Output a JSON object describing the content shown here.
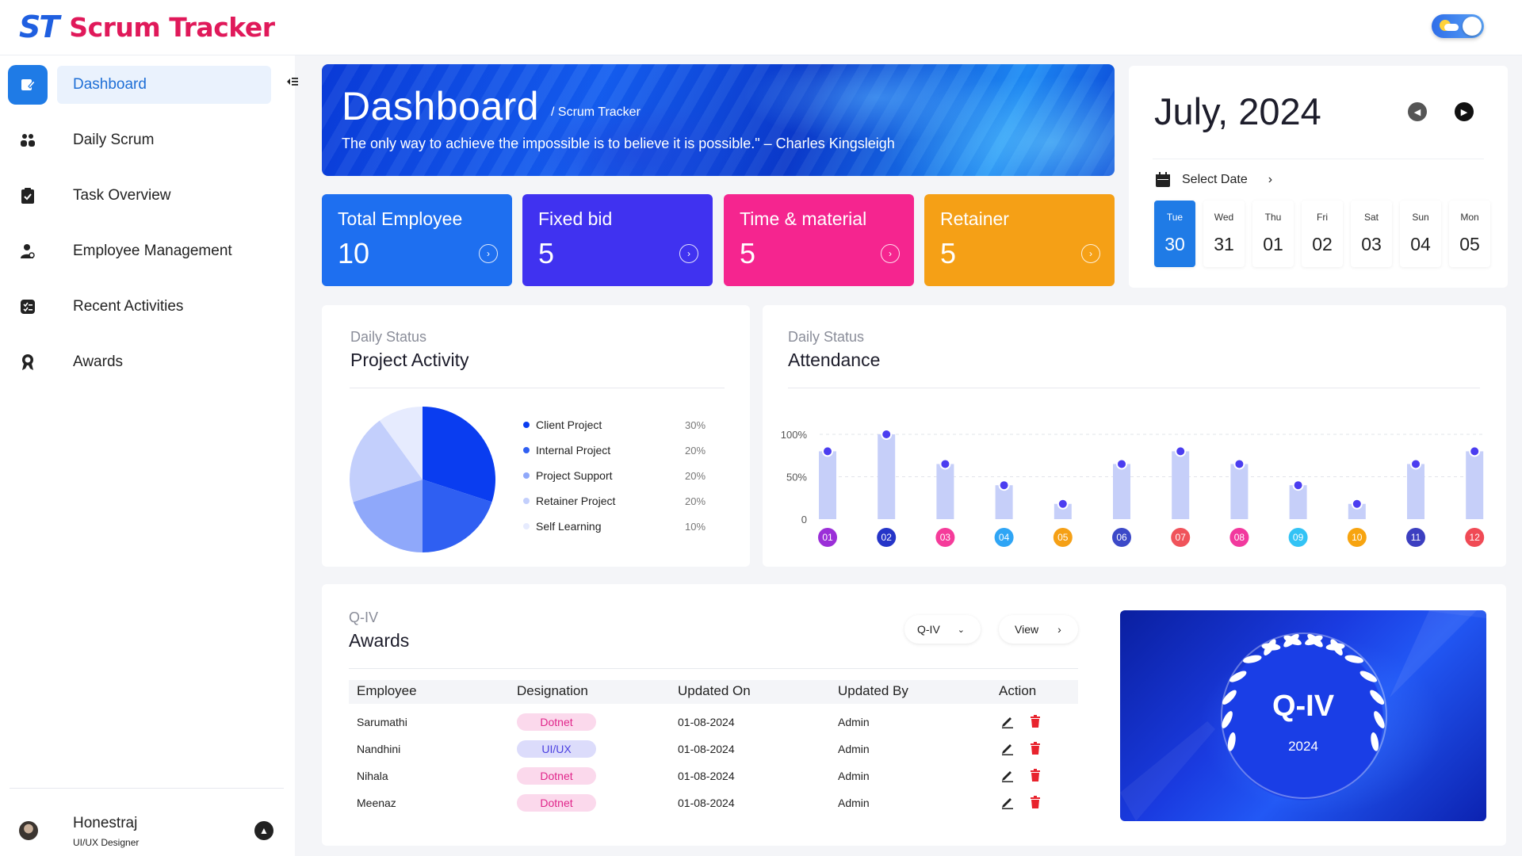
{
  "header": {
    "logo_mark": "ST",
    "logo_text": "Scrum Tracker",
    "theme_toggle": "theme-toggle"
  },
  "sidebar": {
    "items": [
      {
        "label": "Dashboard",
        "icon": "dashboard-icon",
        "active": true
      },
      {
        "label": "Daily Scrum",
        "icon": "team-icon"
      },
      {
        "label": "Task Overview",
        "icon": "clipboard-check-icon"
      },
      {
        "label": "Employee Management",
        "icon": "user-gear-icon"
      },
      {
        "label": "Recent Activities",
        "icon": "checklist-icon"
      },
      {
        "label": "Awards",
        "icon": "award-icon"
      }
    ],
    "user": {
      "name": "Honestraj",
      "role": "UI/UX Designer"
    }
  },
  "banner": {
    "title": "Dashboard",
    "crumb": "/ Scrum Tracker",
    "quote": "The only way to achieve the impossible is to believe it is possible.\" – Charles Kingsleigh"
  },
  "stats": [
    {
      "title": "Total Employee",
      "value": "10",
      "color": "#1e6ff0"
    },
    {
      "title": "Fixed bid",
      "value": "5",
      "color": "#4032f0"
    },
    {
      "title": "Time & material",
      "value": "5",
      "color": "#f5258f"
    },
    {
      "title": "Retainer",
      "value": "5",
      "color": "#f5a016"
    }
  ],
  "calendar": {
    "month": "July, 2024",
    "select_label": "Select Date",
    "days": [
      {
        "dow": "Tue",
        "num": "30",
        "active": true
      },
      {
        "dow": "Wed",
        "num": "31"
      },
      {
        "dow": "Thu",
        "num": "01"
      },
      {
        "dow": "Fri",
        "num": "02"
      },
      {
        "dow": "Sat",
        "num": "03"
      },
      {
        "dow": "Sun",
        "num": "04"
      },
      {
        "dow": "Mon",
        "num": "05"
      }
    ]
  },
  "project_activity": {
    "subtitle": "Daily Status",
    "title": "Project Activity",
    "chart_data": {
      "type": "pie",
      "labels": [
        "Client Project",
        "Internal Project",
        "Project Support",
        "Retainer Project",
        "Self Learning"
      ],
      "values": [
        30,
        20,
        20,
        20,
        10
      ],
      "value_labels": [
        "30%",
        "20%",
        "20%",
        "20%",
        "10%"
      ],
      "colors": [
        "#0a3df0",
        "#2f5ff2",
        "#8fa8fa",
        "#c3cffc",
        "#e6ebfe"
      ]
    }
  },
  "attendance": {
    "subtitle": "Daily Status",
    "title": "Attendance",
    "chart_data": {
      "type": "bar",
      "categories": [
        "01",
        "02",
        "03",
        "04",
        "05",
        "06",
        "07",
        "08",
        "09",
        "10",
        "11",
        "12"
      ],
      "values": [
        80,
        100,
        65,
        40,
        18,
        65,
        80,
        65,
        40,
        18,
        65,
        80
      ],
      "y_ticks": [
        "100%",
        "50%",
        "0"
      ],
      "ylim": [
        0,
        100
      ],
      "grid": true,
      "category_colors": [
        "#9b2fd8",
        "#2535c8",
        "#f53b9a",
        "#2fa5f5",
        "#f5a016",
        "#3c49c8",
        "#f0535b",
        "#f2399e",
        "#33c3f5",
        "#f7a410",
        "#3c3fc0",
        "#f04a55"
      ]
    }
  },
  "awards": {
    "subtitle": "Q-IV",
    "title": "Awards",
    "filter_value": "Q-IV",
    "view_label": "View",
    "columns": [
      "Employee",
      "Designation",
      "Updated On",
      "Updated By",
      "Action"
    ],
    "rows": [
      {
        "employee": "Sarumathi",
        "designation": "Dotnet",
        "updated_on": "01-08-2024",
        "updated_by": "Admin"
      },
      {
        "employee": "Nandhini",
        "designation": "UI/UX",
        "updated_on": "01-08-2024",
        "updated_by": "Admin"
      },
      {
        "employee": "Nihala",
        "designation": "Dotnet",
        "updated_on": "01-08-2024",
        "updated_by": "Admin"
      },
      {
        "employee": "Meenaz",
        "designation": "Dotnet",
        "updated_on": "01-08-2024",
        "updated_by": "Admin"
      }
    ],
    "card": {
      "title": "Q-IV",
      "year": "2024"
    }
  }
}
